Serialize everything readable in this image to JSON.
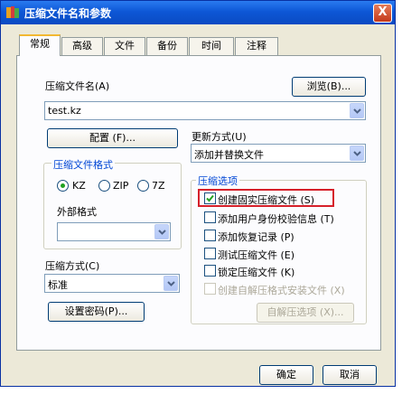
{
  "window": {
    "title": "压缩文件名和参数",
    "close_label": "X"
  },
  "tabs": [
    {
      "label": "常规"
    },
    {
      "label": "高级"
    },
    {
      "label": "文件"
    },
    {
      "label": "备份"
    },
    {
      "label": "时间"
    },
    {
      "label": "注释"
    }
  ],
  "archive_name": {
    "label": "压缩文件名(A)",
    "value": "test.kz",
    "browse_label": "浏览(B)..."
  },
  "profile_button": "配置 (F)...",
  "update_mode": {
    "label": "更新方式(U)",
    "value": "添加并替换文件"
  },
  "format_group": {
    "title": "压缩文件格式",
    "options": [
      {
        "label": "KZ",
        "selected": true
      },
      {
        "label": "ZIP",
        "selected": false
      },
      {
        "label": "7Z",
        "selected": false
      }
    ],
    "external_label": "外部格式",
    "external_value": ""
  },
  "compression": {
    "label": "压缩方式(C)",
    "value": "标准"
  },
  "password_button": "设置密码(P)...",
  "options_group": {
    "title": "压缩选项",
    "items": [
      {
        "label": "创建固实压缩文件 (S)",
        "checked": true,
        "enabled": true
      },
      {
        "label": "添加用户身份校验信息 (T)",
        "checked": false,
        "enabled": true
      },
      {
        "label": "添加恢复记录 (P)",
        "checked": false,
        "enabled": true
      },
      {
        "label": "测试压缩文件 (E)",
        "checked": false,
        "enabled": true
      },
      {
        "label": "锁定压缩文件 (K)",
        "checked": false,
        "enabled": true
      },
      {
        "label": "创建自解压格式安装文件 (X)",
        "checked": false,
        "enabled": false
      }
    ],
    "sfx_button": "自解压选项 (X)..."
  },
  "footer": {
    "ok": "确定",
    "cancel": "取消"
  },
  "colors": {
    "highlight_box": "#d6202a",
    "titlebar": "#0d57d6",
    "group_title": "#0046d5"
  }
}
